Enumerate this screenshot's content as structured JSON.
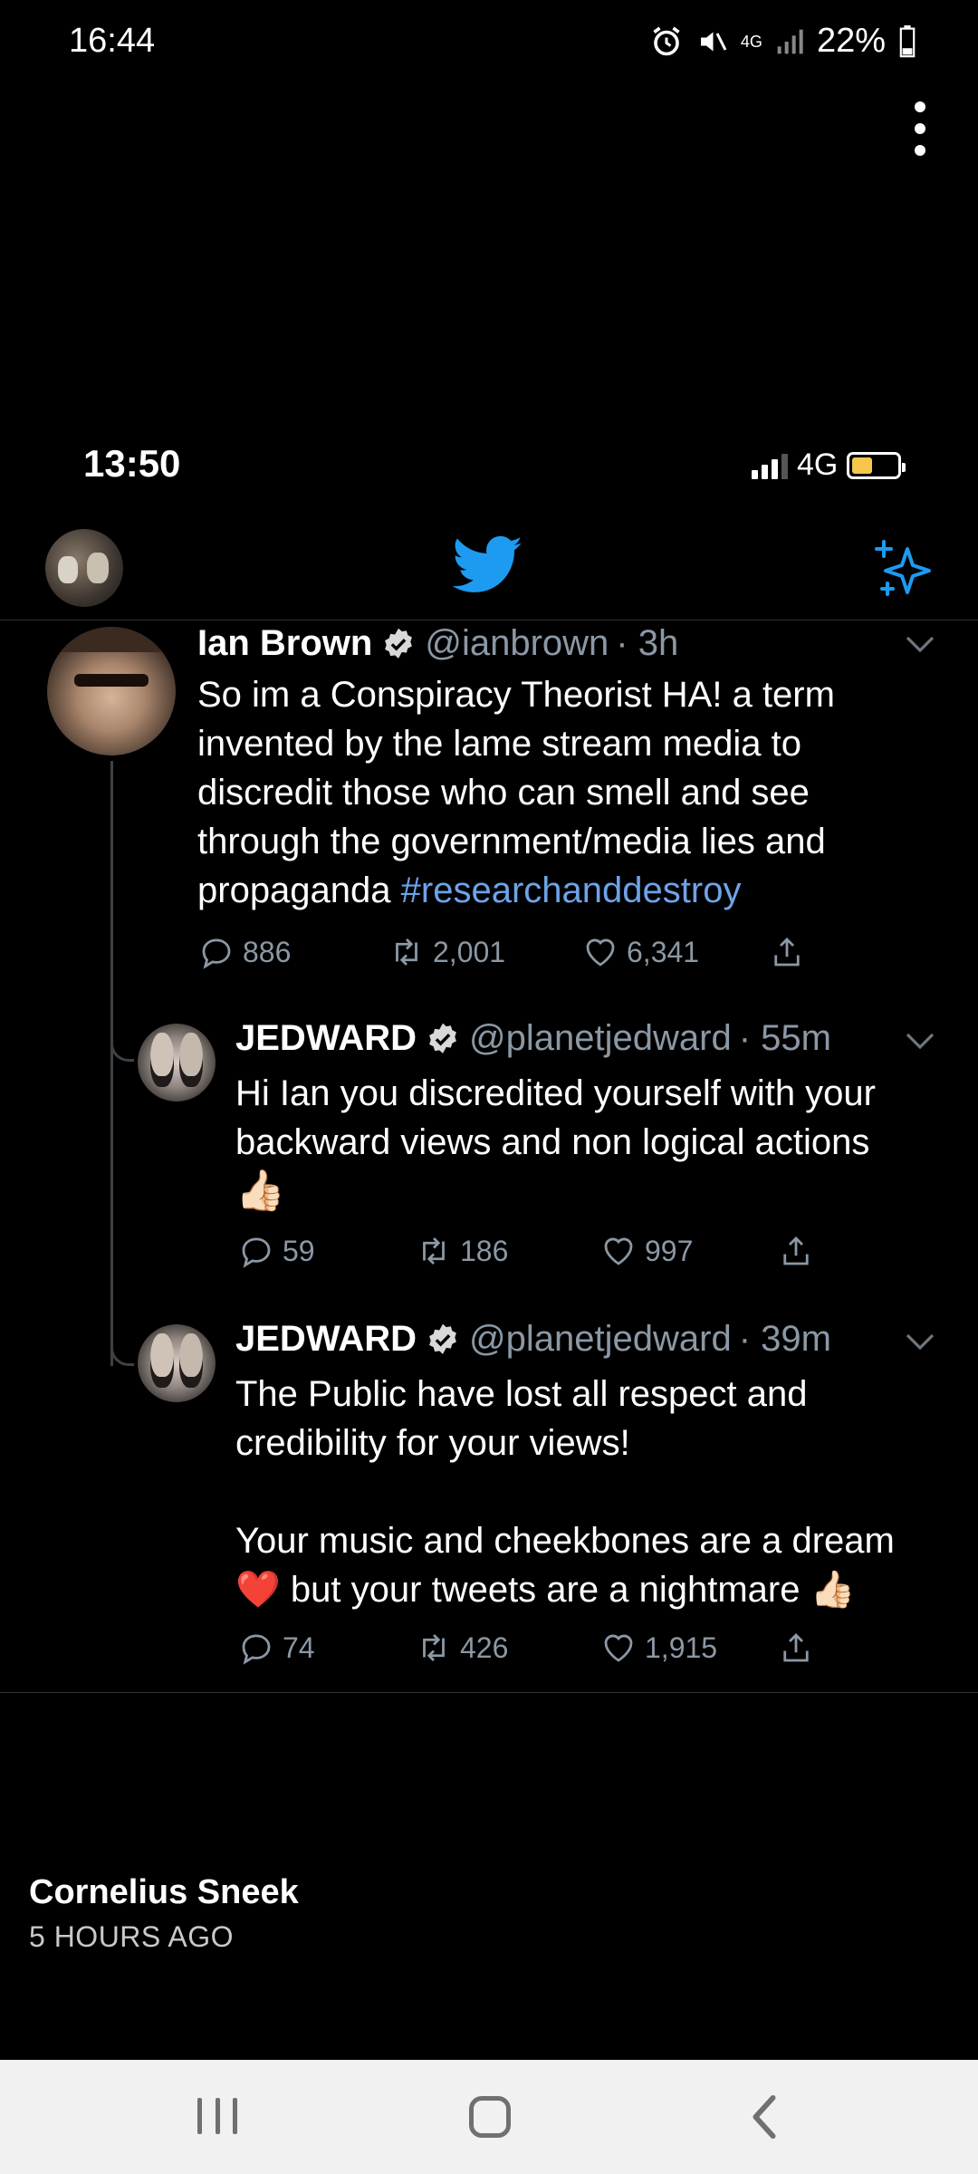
{
  "outer_status": {
    "time": "16:44",
    "network": "4G",
    "battery": "22%"
  },
  "inner_status": {
    "time": "13:50",
    "network": "4G"
  },
  "tweets": [
    {
      "name": "Ian Brown",
      "handle": "@ianbrown",
      "age": "· 3h",
      "text_lines": [
        "So im a Conspiracy Theorist HA! a term",
        "invented by the lame stream media to",
        "discredit those who can smell and see",
        "through the government/media lies and"
      ],
      "text_last_prefix": "propaganda ",
      "hashtag": "#researchanddestroy",
      "replies": "886",
      "retweets": "2,001",
      "likes": "6,341"
    },
    {
      "name": "JEDWARD",
      "handle": "@planetjedward",
      "age": "· 55m",
      "text_lines": [
        "Hi Ian you discredited yourself with your",
        "backward views and non logical actions"
      ],
      "emoji": "👍🏻",
      "replies": "59",
      "retweets": "186",
      "likes": "997"
    },
    {
      "name": "JEDWARD",
      "handle": "@planetjedward",
      "age": "· 39m",
      "text_lines": [
        "The Public have lost all respect and",
        "credibility for your views!",
        "Your music and cheekbones are a dream"
      ],
      "text_last_heart": "❤️",
      "text_last": " but your tweets are a nightmare ",
      "text_last_emoji": "👍🏻",
      "replies": "74",
      "retweets": "426",
      "likes": "1,915"
    }
  ],
  "post": {
    "author": "Cornelius Sneek",
    "time": "5 HOURS AGO"
  },
  "colors": {
    "twitter_blue": "#1d9bf0",
    "hashtag": "#6ea3e8",
    "muted": "#8b98a5"
  }
}
